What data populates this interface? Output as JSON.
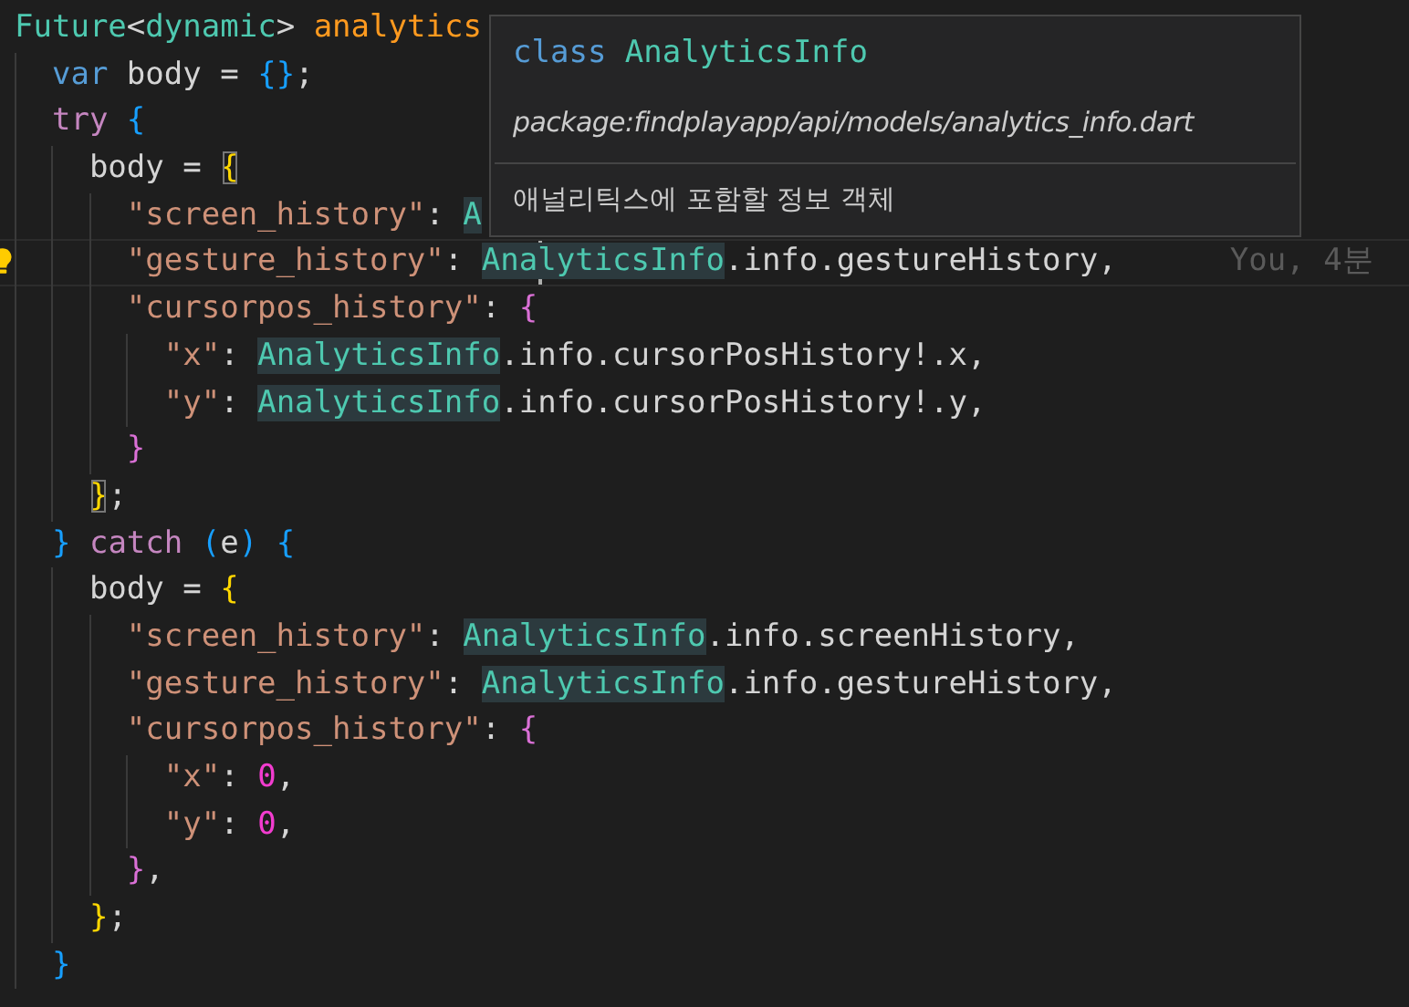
{
  "editor": {
    "lines": [
      {
        "tokens": [
          {
            "text": "Future",
            "kind": "type"
          },
          {
            "text": "<",
            "kind": "plain"
          },
          {
            "text": "dynamic",
            "kind": "type"
          },
          {
            "text": "> ",
            "kind": "plain"
          },
          {
            "text": "analytics",
            "kind": "func"
          }
        ]
      },
      {
        "tokens": [
          {
            "text": "  var ",
            "kind": "keyword"
          },
          {
            "text": "body = ",
            "kind": "plain"
          },
          {
            "text": "{}",
            "kind": "bracket3"
          },
          {
            "text": ";",
            "kind": "plain"
          }
        ]
      },
      {
        "tokens": [
          {
            "text": "  try ",
            "kind": "control"
          },
          {
            "text": "{",
            "kind": "bracket3"
          }
        ]
      },
      {
        "tokens": [
          {
            "text": "    body = ",
            "kind": "plain"
          },
          {
            "text": "{",
            "kind": "bracket1",
            "matched": true
          }
        ]
      },
      {
        "tokens": [
          {
            "text": "      \"screen_history\"",
            "kind": "string"
          },
          {
            "text": ": ",
            "kind": "plain"
          },
          {
            "text": "A",
            "kind": "type",
            "highlighted": true
          }
        ]
      },
      {
        "current": true,
        "lightbulb": true,
        "annotation": "You, 4분",
        "tokens": [
          {
            "text": "      \"gesture_history\"",
            "kind": "string"
          },
          {
            "text": ": ",
            "kind": "plain"
          },
          {
            "text": "Ana",
            "kind": "type",
            "highlighted": true,
            "cursor": true
          },
          {
            "text": "lyticsInfo",
            "kind": "type",
            "highlighted": true
          },
          {
            "text": ".info.gestureHistory,",
            "kind": "plain"
          }
        ]
      },
      {
        "tokens": [
          {
            "text": "      \"cursorpos_history\"",
            "kind": "string"
          },
          {
            "text": ": ",
            "kind": "plain"
          },
          {
            "text": "{",
            "kind": "bracket2"
          }
        ]
      },
      {
        "tokens": [
          {
            "text": "        \"x\"",
            "kind": "string"
          },
          {
            "text": ": ",
            "kind": "plain"
          },
          {
            "text": "AnalyticsInfo",
            "kind": "type",
            "highlighted": true
          },
          {
            "text": ".info.cursorPosHistory!.x,",
            "kind": "plain"
          }
        ]
      },
      {
        "tokens": [
          {
            "text": "        \"y\"",
            "kind": "string"
          },
          {
            "text": ": ",
            "kind": "plain"
          },
          {
            "text": "AnalyticsInfo",
            "kind": "type",
            "highlighted": true
          },
          {
            "text": ".info.cursorPosHistory!.y,",
            "kind": "plain"
          }
        ]
      },
      {
        "tokens": [
          {
            "text": "      }",
            "kind": "bracket2"
          }
        ]
      },
      {
        "tokens": [
          {
            "text": "    }",
            "kind": "bracket1",
            "matched": true
          },
          {
            "text": ";",
            "kind": "plain"
          }
        ]
      },
      {
        "tokens": [
          {
            "text": "  }",
            "kind": "bracket3"
          },
          {
            "text": " catch ",
            "kind": "control"
          },
          {
            "text": "(",
            "kind": "bracket3"
          },
          {
            "text": "e",
            "kind": "plain"
          },
          {
            "text": ") {",
            "kind": "bracket3"
          }
        ]
      },
      {
        "tokens": [
          {
            "text": "    body = ",
            "kind": "plain"
          },
          {
            "text": "{",
            "kind": "bracket1"
          }
        ]
      },
      {
        "tokens": [
          {
            "text": "      \"screen_history\"",
            "kind": "string"
          },
          {
            "text": ": ",
            "kind": "plain"
          },
          {
            "text": "AnalyticsInfo",
            "kind": "type",
            "highlighted": true
          },
          {
            "text": ".info.screenHistory,",
            "kind": "plain"
          }
        ]
      },
      {
        "tokens": [
          {
            "text": "      \"gesture_history\"",
            "kind": "string"
          },
          {
            "text": ": ",
            "kind": "plain"
          },
          {
            "text": "AnalyticsInfo",
            "kind": "type",
            "highlighted": true
          },
          {
            "text": ".info.gestureHistory,",
            "kind": "plain"
          }
        ]
      },
      {
        "tokens": [
          {
            "text": "      \"cursorpos_history\"",
            "kind": "string"
          },
          {
            "text": ": ",
            "kind": "plain"
          },
          {
            "text": "{",
            "kind": "bracket2"
          }
        ]
      },
      {
        "tokens": [
          {
            "text": "        \"x\"",
            "kind": "string"
          },
          {
            "text": ": ",
            "kind": "plain"
          },
          {
            "text": "0",
            "kind": "number"
          },
          {
            "text": ",",
            "kind": "plain"
          }
        ]
      },
      {
        "tokens": [
          {
            "text": "        \"y\"",
            "kind": "string"
          },
          {
            "text": ": ",
            "kind": "plain"
          },
          {
            "text": "0",
            "kind": "number"
          },
          {
            "text": ",",
            "kind": "plain"
          }
        ]
      },
      {
        "tokens": [
          {
            "text": "      }",
            "kind": "bracket2"
          },
          {
            "text": ",",
            "kind": "plain"
          }
        ]
      },
      {
        "tokens": [
          {
            "text": "    }",
            "kind": "bracket1"
          },
          {
            "text": ";",
            "kind": "plain"
          }
        ]
      },
      {
        "tokens": [
          {
            "text": "  }",
            "kind": "bracket3"
          }
        ]
      }
    ]
  },
  "hover": {
    "signature": [
      {
        "text": "class ",
        "kind": "keyword"
      },
      {
        "text": "AnalyticsInfo",
        "kind": "type"
      }
    ],
    "path": "package:findplayapp/api/models/analytics_info.dart",
    "description": "애널리틱스에 포함할 정보 객체"
  }
}
